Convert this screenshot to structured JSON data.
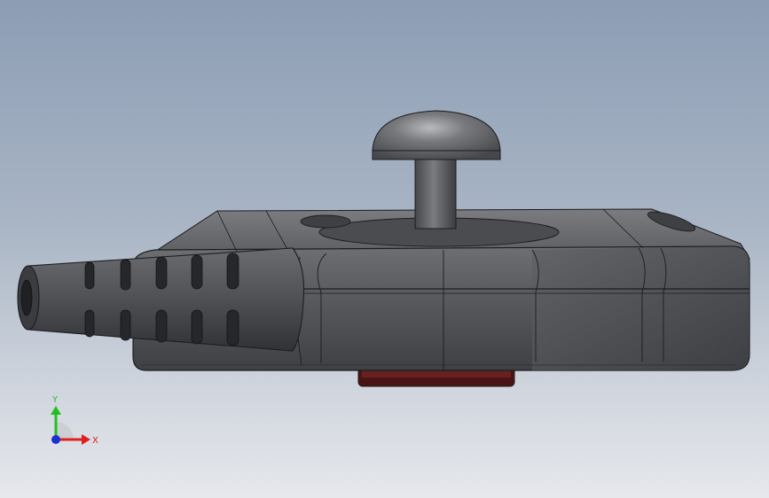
{
  "viewport": {
    "background_top": "#8c9db4",
    "background_bottom": "#e6e8ec"
  },
  "model": {
    "name": "joystick-controller",
    "body_color": "#55575b",
    "edge_color": "#1c1c1e",
    "base_pad_color": "#5a1e1e"
  },
  "triad": {
    "x_label": "X",
    "y_label": "Y",
    "x_color": "#e02020",
    "y_color": "#20c020",
    "z_color": "#2030d0"
  }
}
